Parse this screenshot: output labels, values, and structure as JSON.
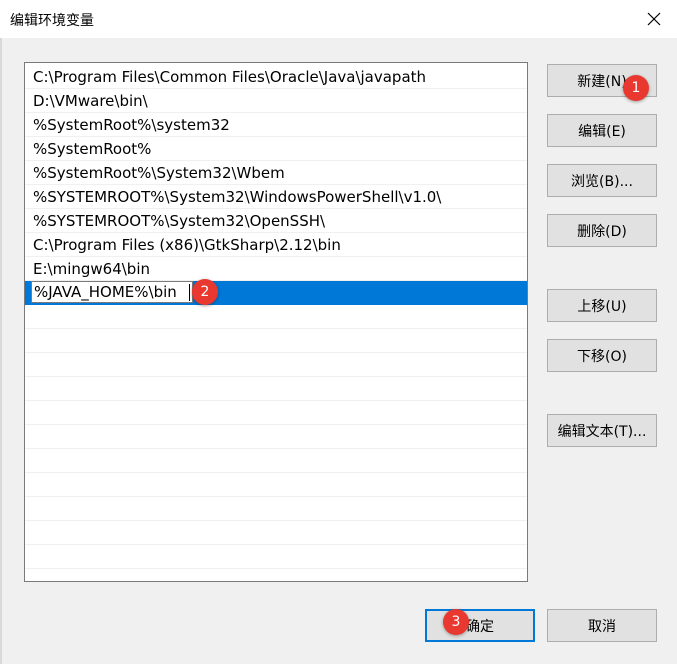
{
  "window": {
    "title": "编辑环境变量",
    "close_icon": "close-icon"
  },
  "paths": [
    "C:\\Program Files\\Common Files\\Oracle\\Java\\javapath",
    "D:\\VMware\\bin\\",
    "%SystemRoot%\\system32",
    "%SystemRoot%",
    "%SystemRoot%\\System32\\Wbem",
    "%SYSTEMROOT%\\System32\\WindowsPowerShell\\v1.0\\",
    "%SYSTEMROOT%\\System32\\OpenSSH\\",
    "C:\\Program Files (x86)\\GtkSharp\\2.12\\bin",
    "E:\\mingw64\\bin"
  ],
  "editing_value": "%JAVA_HOME%\\bin",
  "buttons": {
    "new": "新建(N)",
    "edit": "编辑(E)",
    "browse": "浏览(B)...",
    "delete": "删除(D)",
    "move_up": "上移(U)",
    "move_down": "下移(O)",
    "edit_text": "编辑文本(T)...",
    "ok": "确定",
    "cancel": "取消"
  },
  "badges": {
    "one": "1",
    "two": "2",
    "three": "3"
  },
  "colors": {
    "selection": "#0078d7",
    "badge": "#e8382f"
  }
}
